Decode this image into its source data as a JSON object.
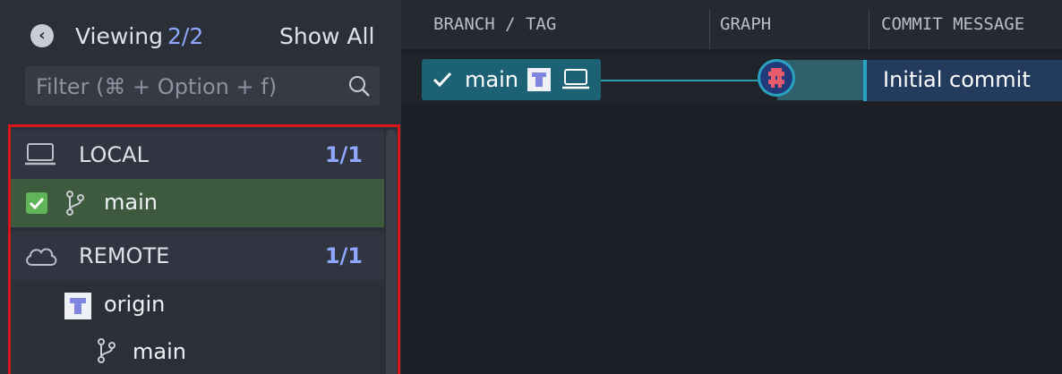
{
  "header": {
    "viewing_label": "Viewing",
    "viewing_count": "2/2",
    "show_all": "Show All",
    "filter_placeholder": "Filter (⌘ + Option + f)"
  },
  "tree": {
    "local": {
      "label": "LOCAL",
      "count": "1/1",
      "icon": "laptop-icon"
    },
    "local_branch": {
      "label": "main",
      "checked": true,
      "icon": "branch-icon"
    },
    "remote": {
      "label": "REMOTE",
      "count": "1/1",
      "icon": "cloud-icon"
    },
    "remote_origin": {
      "label": "origin",
      "icon": "remote-avatar-icon"
    },
    "remote_branch": {
      "label": "main",
      "icon": "branch-icon"
    }
  },
  "columns": {
    "branch_tag": "BRANCH / TAG",
    "graph": "GRAPH",
    "commit_message": "COMMIT MESSAGE"
  },
  "commit": {
    "branch": "main",
    "message": "Initial commit"
  },
  "colors": {
    "accent": "#8fa7ff",
    "selected_row": "#3d5a3e",
    "branch_pill": "#1d6274",
    "graph_line": "#2c9bb0",
    "highlight_border": "#d9141b"
  }
}
